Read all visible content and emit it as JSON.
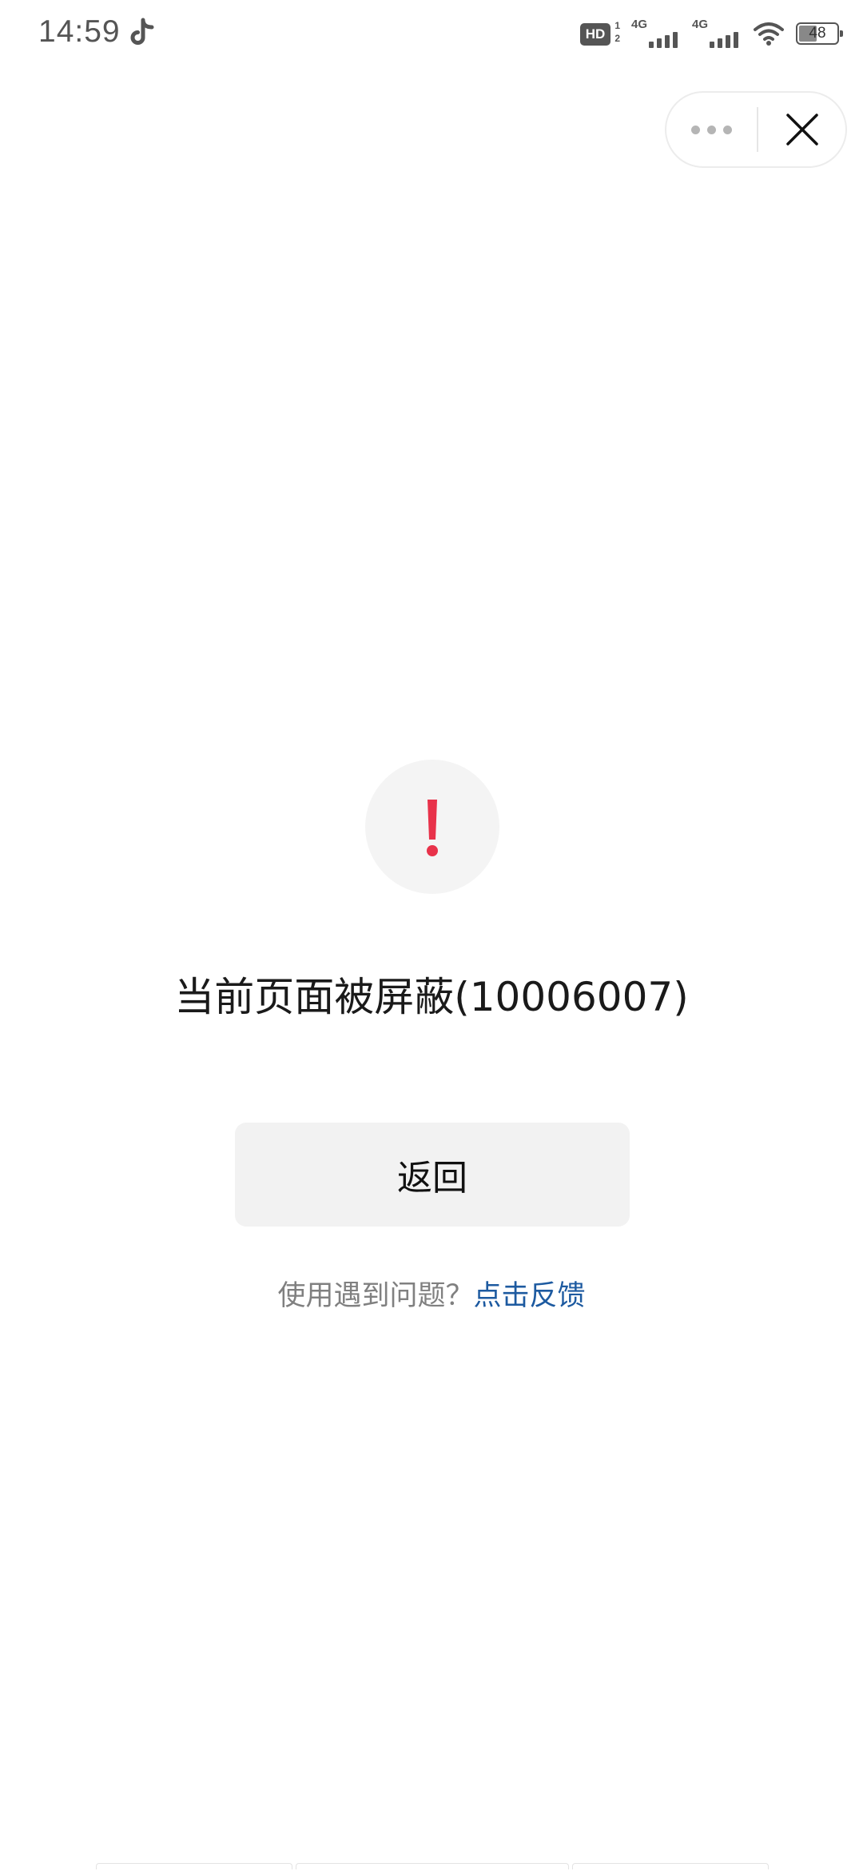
{
  "status_bar": {
    "time": "14:59",
    "app_icon": "tiktok-icon",
    "hd_label": "HD",
    "hd_sub_top": "1",
    "hd_sub_bottom": "2",
    "sim1_network": "4G",
    "sim2_network": "4G",
    "battery_level": "48"
  },
  "capsule": {
    "more_icon": "more-dots-icon",
    "close_icon": "close-icon"
  },
  "error": {
    "icon": "exclamation-icon",
    "accent_color": "#e8324a",
    "title": "当前页面被屏蔽(10006007)",
    "back_label": "返回",
    "feedback_prompt": "使用遇到问题？",
    "feedback_link": "点击反馈",
    "link_color": "#1d5aa0"
  }
}
